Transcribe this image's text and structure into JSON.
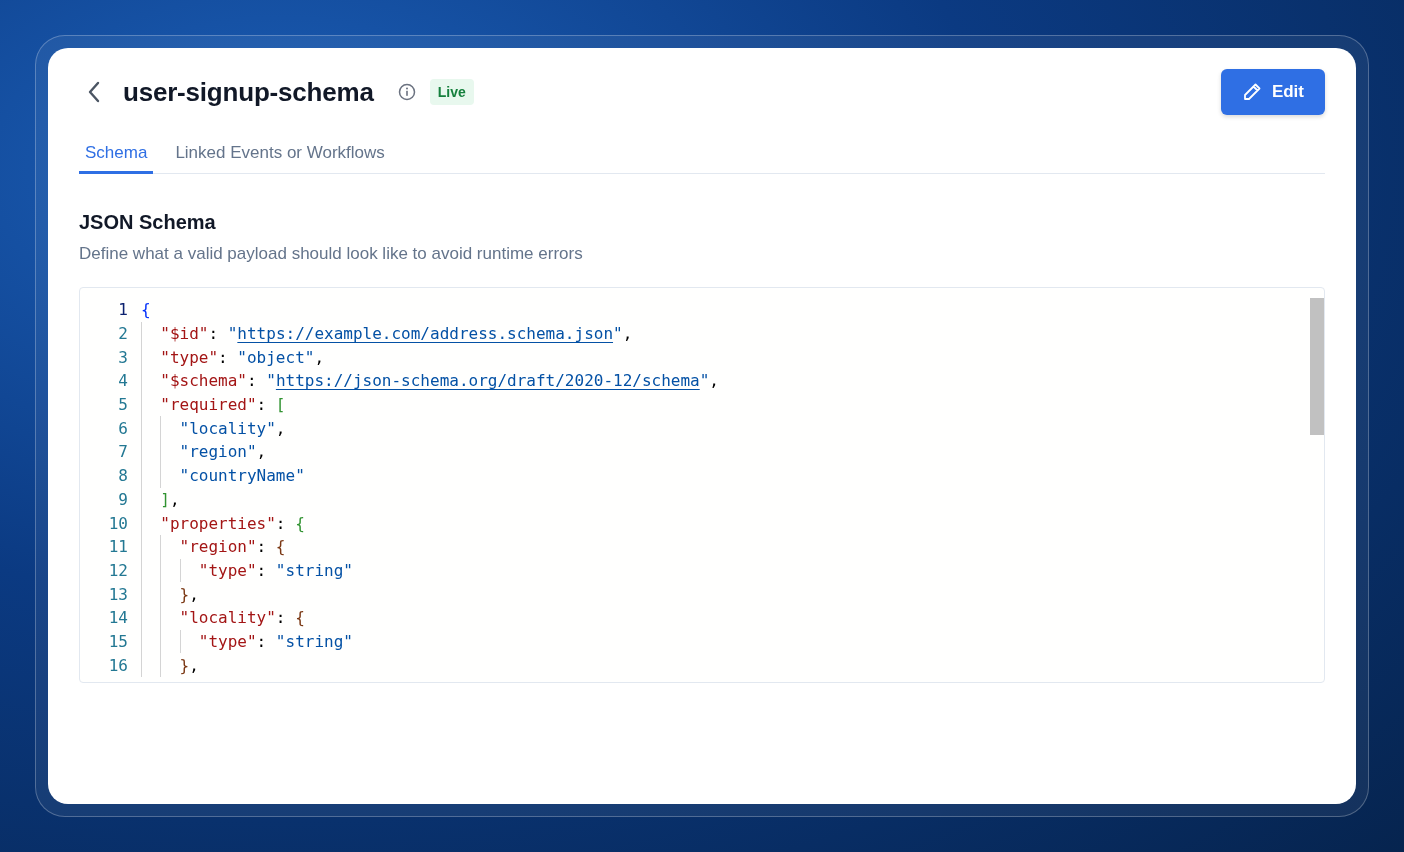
{
  "header": {
    "title": "user-signup-schema",
    "status": "Live",
    "edit_button": "Edit"
  },
  "tabs": [
    {
      "label": "Schema",
      "selected": true
    },
    {
      "label": "Linked Events or Workflows",
      "selected": false
    }
  ],
  "section": {
    "title": "JSON Schema",
    "description": "Define what a valid payload should look like to avoid runtime errors"
  },
  "editor": {
    "lines": [
      {
        "number": "1",
        "current": true,
        "tokens": [
          {
            "kind": "brace1",
            "text": "{"
          }
        ]
      },
      {
        "number": "2",
        "current": false,
        "tokens": [
          {
            "kind": "key",
            "text": "  \"$id\""
          },
          {
            "kind": "punct",
            "text": ": "
          },
          {
            "kind": "string",
            "text": "\""
          },
          {
            "kind": "link",
            "text": "https://example.com/address.schema.json"
          },
          {
            "kind": "string",
            "text": "\""
          },
          {
            "kind": "punct",
            "text": ","
          }
        ]
      },
      {
        "number": "3",
        "current": false,
        "tokens": [
          {
            "kind": "key",
            "text": "  \"type\""
          },
          {
            "kind": "punct",
            "text": ": "
          },
          {
            "kind": "string",
            "text": "\"object\""
          },
          {
            "kind": "punct",
            "text": ","
          }
        ]
      },
      {
        "number": "4",
        "current": false,
        "tokens": [
          {
            "kind": "key",
            "text": "  \"$schema\""
          },
          {
            "kind": "punct",
            "text": ": "
          },
          {
            "kind": "string",
            "text": "\""
          },
          {
            "kind": "link",
            "text": "https://json-schema.org/draft/2020-12/schema"
          },
          {
            "kind": "string",
            "text": "\""
          },
          {
            "kind": "punct",
            "text": ","
          }
        ]
      },
      {
        "number": "5",
        "current": false,
        "tokens": [
          {
            "kind": "key",
            "text": "  \"required\""
          },
          {
            "kind": "punct",
            "text": ": "
          },
          {
            "kind": "brace2",
            "text": "["
          }
        ]
      },
      {
        "number": "6",
        "current": false,
        "tokens": [
          {
            "kind": "string",
            "text": "    \"locality\""
          },
          {
            "kind": "punct",
            "text": ","
          }
        ]
      },
      {
        "number": "7",
        "current": false,
        "tokens": [
          {
            "kind": "string",
            "text": "    \"region\""
          },
          {
            "kind": "punct",
            "text": ","
          }
        ]
      },
      {
        "number": "8",
        "current": false,
        "tokens": [
          {
            "kind": "string",
            "text": "    \"countryName\""
          }
        ]
      },
      {
        "number": "9",
        "current": false,
        "tokens": [
          {
            "kind": "brace2",
            "text": "  ]"
          },
          {
            "kind": "punct",
            "text": ","
          }
        ]
      },
      {
        "number": "10",
        "current": false,
        "tokens": [
          {
            "kind": "key",
            "text": "  \"properties\""
          },
          {
            "kind": "punct",
            "text": ": "
          },
          {
            "kind": "brace2",
            "text": "{"
          }
        ]
      },
      {
        "number": "11",
        "current": false,
        "tokens": [
          {
            "kind": "key",
            "text": "    \"region\""
          },
          {
            "kind": "punct",
            "text": ": "
          },
          {
            "kind": "brace3",
            "text": "{"
          }
        ]
      },
      {
        "number": "12",
        "current": false,
        "tokens": [
          {
            "kind": "key",
            "text": "      \"type\""
          },
          {
            "kind": "punct",
            "text": ": "
          },
          {
            "kind": "string",
            "text": "\"string\""
          }
        ]
      },
      {
        "number": "13",
        "current": false,
        "tokens": [
          {
            "kind": "brace3",
            "text": "    }"
          },
          {
            "kind": "punct",
            "text": ","
          }
        ]
      },
      {
        "number": "14",
        "current": false,
        "tokens": [
          {
            "kind": "key",
            "text": "    \"locality\""
          },
          {
            "kind": "punct",
            "text": ": "
          },
          {
            "kind": "brace3",
            "text": "{"
          }
        ]
      },
      {
        "number": "15",
        "current": false,
        "tokens": [
          {
            "kind": "key",
            "text": "      \"type\""
          },
          {
            "kind": "punct",
            "text": ": "
          },
          {
            "kind": "string",
            "text": "\"string\""
          }
        ]
      },
      {
        "number": "16",
        "current": false,
        "tokens": [
          {
            "kind": "brace3",
            "text": "    }"
          },
          {
            "kind": "punct",
            "text": ","
          }
        ]
      }
    ]
  }
}
